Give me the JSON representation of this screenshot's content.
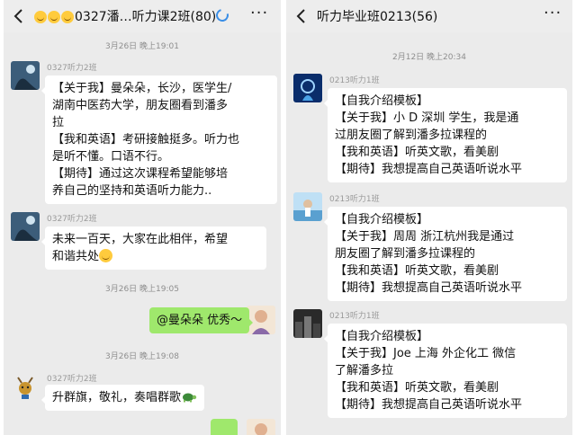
{
  "left": {
    "title": "0327潘…听力课2班(80)",
    "title_emojis": [
      "smiling-face",
      "smiling-face",
      "smiling-face"
    ],
    "messages": [
      {
        "time": "3月26日 晚上19:01"
      },
      {
        "sender": "0327听力2班",
        "lines": [
          "【关于我】曼朵朵，长沙，医学生/",
          "湖南中医药大学，朋友圈看到潘多",
          "拉",
          "【我和英语】考研接触挺多。听力也",
          "是听不懂。口语不行。",
          "【期待】通过这次课程希望能够培",
          "养自己的坚持和英语听力能力.."
        ]
      },
      {
        "sender": "0327听力2班",
        "lines": [
          "未来一百天，大家在此相伴，希望",
          "和谐共处"
        ],
        "emoji": "smiling-face"
      },
      {
        "time": "3月26日 晚上19:05"
      },
      {
        "self_text": "@曼朵朵 优秀～"
      },
      {
        "time": "3月26日 晚上19:08"
      },
      {
        "sender": "0327听力2班",
        "lines": [
          "升群旗，敬礼，奏唱群歌"
        ],
        "emoji": "turtle"
      }
    ]
  },
  "right": {
    "title": "听力毕业班0213(56)",
    "messages": [
      {
        "time": "2月12日 晚上20:34"
      },
      {
        "sender": "0213听力1班",
        "lines": [
          "【自我介绍模板】",
          "【关于我】小 D 深圳 学生，我是通",
          "过朋友圈了解到潘多拉课程的",
          "【我和英语】听英文歌，看美剧",
          "【期待】我想提高自己英语听说水平"
        ]
      },
      {
        "sender": "0213听力1班",
        "lines": [
          "【自我介绍模板】",
          "【关于我】周周   浙江杭州我是通过",
          "朋友圈了解到潘多拉课程的",
          "【我和英语】听英文歌，看美剧",
          "【期待】我想提高自己英语听说水平"
        ]
      },
      {
        "sender": "0213听力1班",
        "lines": [
          "【自我介绍模板】",
          "【关于我】Joe 上海 外企化工 微信",
          "了解潘多拉",
          "【我和英语】听英文歌，看美剧",
          "【期待】我想提高自己英语听说水平"
        ]
      }
    ]
  },
  "icons": {
    "back": "back-chevron-icon",
    "more": "more-dots-icon",
    "refresh": "refresh-spinner-icon"
  },
  "colors": {
    "self_bubble": "#9fe86c",
    "incoming_bubble": "#ffffff",
    "chat_background": "#ebebeb"
  }
}
